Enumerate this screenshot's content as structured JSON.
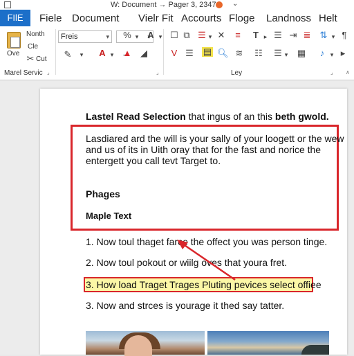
{
  "titlebar": {
    "title": "W: Document → Pager 3, 2347",
    "chevron": "⌄"
  },
  "menu": {
    "file": "FIlE",
    "items": [
      "Fiele",
      "Document",
      "Vielr Fit",
      "Accourts",
      "Floge",
      "Landnoss",
      "Helt"
    ]
  },
  "ribbon": {
    "clipboard": {
      "month": "Nonth",
      "cle": "Cle",
      "ove": "Ove",
      "cut": "Cut",
      "group_label": "Marel Servic"
    },
    "font": {
      "name": "Freis",
      "size": ""
    },
    "group_label_mid": "Ley"
  },
  "document": {
    "heading_bold": "Lastel Read Selection",
    "heading_rest": " that ingus of an this ",
    "heading_bold2": "beth gwold.",
    "para_lines": [
      "Lasdiared ard the will is your sally of your loogett or the wew",
      "and us of its in Uith oray that for the fast and norice the",
      "entergett you call tevt Target to."
    ],
    "sub1": "Phages",
    "sub2": "Maple Text",
    "list": [
      "1.  Now toul thaget farce the offect you was person tinge.",
      "2.  Now toul pokout or wiilg oves that youra fret.",
      "3. How load Traget Trages Pluting pevices select offiee",
      "3.  Now and strces is yourage it thed say tatter."
    ]
  },
  "colors": {
    "accent": "#1c6fc9",
    "highlight": "#fbf7a6",
    "annotation_red": "#d9262b"
  }
}
